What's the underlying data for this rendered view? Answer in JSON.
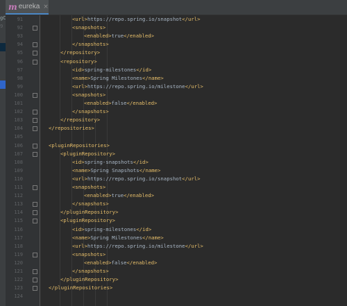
{
  "tab": {
    "icon": "m",
    "label": "eureka",
    "close": "×"
  },
  "sidebar_fragments": [
    "gC",
    "9"
  ],
  "lines": [
    {
      "num": "91",
      "indent": 4,
      "fold": false,
      "parts": [
        {
          "t": "<url>",
          "c": "tg"
        },
        {
          "t": "https://repo.spring.io/snapshot",
          "c": "tx"
        },
        {
          "t": "</url>",
          "c": "tg"
        }
      ]
    },
    {
      "num": "92",
      "indent": 4,
      "fold": true,
      "parts": [
        {
          "t": "<snapshots>",
          "c": "tg"
        }
      ]
    },
    {
      "num": "93",
      "indent": 5,
      "fold": false,
      "parts": [
        {
          "t": "<enabled>",
          "c": "tg"
        },
        {
          "t": "true",
          "c": "tx"
        },
        {
          "t": "</enabled>",
          "c": "tg"
        }
      ]
    },
    {
      "num": "94",
      "indent": 4,
      "fold": true,
      "parts": [
        {
          "t": "</snapshots>",
          "c": "tg"
        }
      ]
    },
    {
      "num": "95",
      "indent": 3,
      "fold": true,
      "parts": [
        {
          "t": "</repository>",
          "c": "tg"
        }
      ]
    },
    {
      "num": "96",
      "indent": 3,
      "fold": true,
      "parts": [
        {
          "t": "<repository>",
          "c": "tg"
        }
      ]
    },
    {
      "num": "97",
      "indent": 4,
      "fold": false,
      "parts": [
        {
          "t": "<id>",
          "c": "tg"
        },
        {
          "t": "spring-milestones",
          "c": "tx"
        },
        {
          "t": "</id>",
          "c": "tg"
        }
      ]
    },
    {
      "num": "98",
      "indent": 4,
      "fold": false,
      "parts": [
        {
          "t": "<name>",
          "c": "tg"
        },
        {
          "t": "Spring Milestones",
          "c": "tx"
        },
        {
          "t": "</name>",
          "c": "tg"
        }
      ]
    },
    {
      "num": "99",
      "indent": 4,
      "fold": false,
      "parts": [
        {
          "t": "<url>",
          "c": "tg"
        },
        {
          "t": "https://repo.spring.io/milestone",
          "c": "tx"
        },
        {
          "t": "</url>",
          "c": "tg"
        }
      ]
    },
    {
      "num": "100",
      "indent": 4,
      "fold": true,
      "parts": [
        {
          "t": "<snapshots>",
          "c": "tg"
        }
      ]
    },
    {
      "num": "101",
      "indent": 5,
      "fold": false,
      "parts": [
        {
          "t": "<enabled>",
          "c": "tg"
        },
        {
          "t": "false",
          "c": "tx"
        },
        {
          "t": "</enabled>",
          "c": "tg"
        }
      ]
    },
    {
      "num": "102",
      "indent": 4,
      "fold": true,
      "parts": [
        {
          "t": "</snapshots>",
          "c": "tg"
        }
      ]
    },
    {
      "num": "103",
      "indent": 3,
      "fold": true,
      "parts": [
        {
          "t": "</repository>",
          "c": "tg"
        }
      ]
    },
    {
      "num": "104",
      "indent": 2,
      "fold": true,
      "parts": [
        {
          "t": "</repositories>",
          "c": "tg"
        }
      ]
    },
    {
      "num": "105",
      "indent": 0,
      "fold": false,
      "parts": []
    },
    {
      "num": "106",
      "indent": 2,
      "fold": true,
      "parts": [
        {
          "t": "<pluginRepositories>",
          "c": "tg"
        }
      ]
    },
    {
      "num": "107",
      "indent": 3,
      "fold": true,
      "parts": [
        {
          "t": "<pluginRepository>",
          "c": "tg"
        }
      ]
    },
    {
      "num": "108",
      "indent": 4,
      "fold": false,
      "parts": [
        {
          "t": "<id>",
          "c": "tg"
        },
        {
          "t": "spring-snapshots",
          "c": "tx"
        },
        {
          "t": "</id>",
          "c": "tg"
        }
      ]
    },
    {
      "num": "109",
      "indent": 4,
      "fold": false,
      "parts": [
        {
          "t": "<name>",
          "c": "tg"
        },
        {
          "t": "Spring Snapshots",
          "c": "tx"
        },
        {
          "t": "</name>",
          "c": "tg"
        }
      ]
    },
    {
      "num": "110",
      "indent": 4,
      "fold": false,
      "parts": [
        {
          "t": "<url>",
          "c": "tg"
        },
        {
          "t": "https://repo.spring.io/snapshot",
          "c": "tx"
        },
        {
          "t": "</url>",
          "c": "tg"
        }
      ]
    },
    {
      "num": "111",
      "indent": 4,
      "fold": true,
      "parts": [
        {
          "t": "<snapshots>",
          "c": "tg"
        }
      ]
    },
    {
      "num": "112",
      "indent": 5,
      "fold": false,
      "parts": [
        {
          "t": "<enabled>",
          "c": "tg"
        },
        {
          "t": "true",
          "c": "tx"
        },
        {
          "t": "</enabled>",
          "c": "tg"
        }
      ]
    },
    {
      "num": "113",
      "indent": 4,
      "fold": true,
      "parts": [
        {
          "t": "</snapshots>",
          "c": "tg"
        }
      ]
    },
    {
      "num": "114",
      "indent": 3,
      "fold": true,
      "parts": [
        {
          "t": "</pluginRepository>",
          "c": "tg"
        }
      ]
    },
    {
      "num": "115",
      "indent": 3,
      "fold": true,
      "parts": [
        {
          "t": "<pluginRepository>",
          "c": "tg"
        }
      ]
    },
    {
      "num": "116",
      "indent": 4,
      "fold": false,
      "parts": [
        {
          "t": "<id>",
          "c": "tg"
        },
        {
          "t": "spring-milestones",
          "c": "tx"
        },
        {
          "t": "</id>",
          "c": "tg"
        }
      ]
    },
    {
      "num": "117",
      "indent": 4,
      "fold": false,
      "parts": [
        {
          "t": "<name>",
          "c": "tg"
        },
        {
          "t": "Spring Milestones",
          "c": "tx"
        },
        {
          "t": "</name>",
          "c": "tg"
        }
      ]
    },
    {
      "num": "118",
      "indent": 4,
      "fold": false,
      "parts": [
        {
          "t": "<url>",
          "c": "tg"
        },
        {
          "t": "https://repo.spring.io/milestone",
          "c": "tx"
        },
        {
          "t": "</url>",
          "c": "tg"
        }
      ]
    },
    {
      "num": "119",
      "indent": 4,
      "fold": true,
      "parts": [
        {
          "t": "<snapshots>",
          "c": "tg"
        }
      ]
    },
    {
      "num": "120",
      "indent": 5,
      "fold": false,
      "parts": [
        {
          "t": "<enabled>",
          "c": "tg"
        },
        {
          "t": "false",
          "c": "tx"
        },
        {
          "t": "</enabled>",
          "c": "tg"
        }
      ]
    },
    {
      "num": "121",
      "indent": 4,
      "fold": true,
      "parts": [
        {
          "t": "</snapshots>",
          "c": "tg"
        }
      ]
    },
    {
      "num": "122",
      "indent": 3,
      "fold": true,
      "parts": [
        {
          "t": "</pluginRepository>",
          "c": "tg"
        }
      ]
    },
    {
      "num": "123",
      "indent": 2,
      "fold": true,
      "parts": [
        {
          "t": "</pluginRepositories>",
          "c": "tg"
        }
      ]
    },
    {
      "num": "124",
      "indent": 0,
      "fold": false,
      "parts": []
    }
  ]
}
